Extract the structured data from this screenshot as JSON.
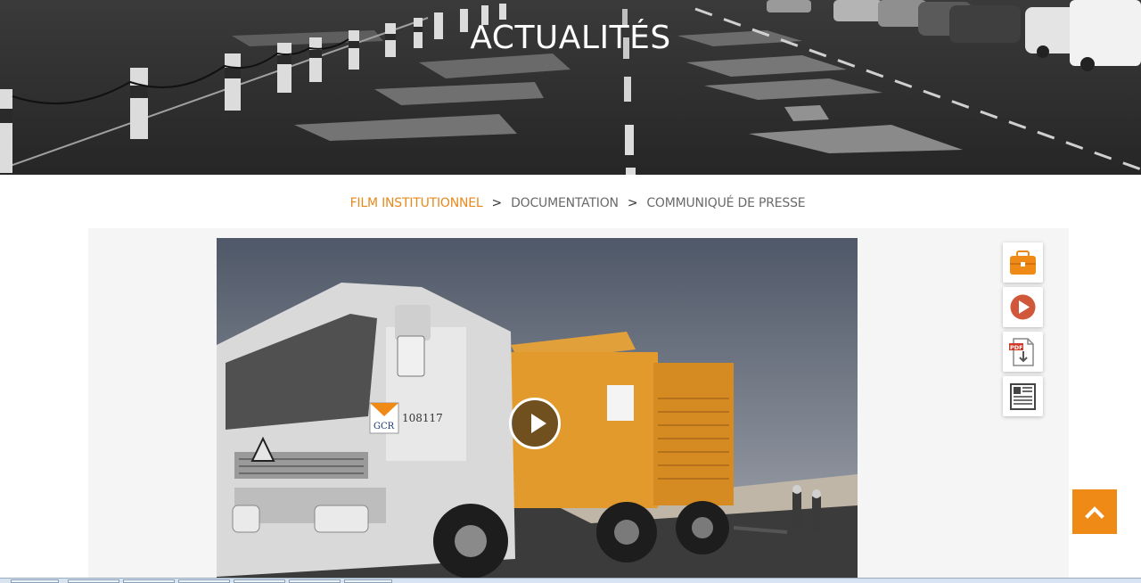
{
  "header": {
    "title": "ACTUALITÉS"
  },
  "breadcrumb": {
    "items": [
      {
        "label": "FILM INSTITUTIONNEL",
        "active": true
      },
      {
        "label": "DOCUMENTATION",
        "active": false
      },
      {
        "label": "COMMUNIQUÉ DE PRESSE",
        "active": false
      }
    ],
    "separator": ">"
  },
  "video": {
    "truck_number": "108117",
    "truck_logo": "GCR",
    "play_icon": "play-circle-icon"
  },
  "sidebar": {
    "items": [
      {
        "icon": "briefcase-icon"
      },
      {
        "icon": "play-icon"
      },
      {
        "icon": "pdf-download-icon"
      },
      {
        "icon": "newspaper-icon"
      }
    ]
  },
  "colors": {
    "accent": "#e8891d",
    "back_to_top": "#f08a17",
    "play_red": "#d0573a"
  },
  "back_to_top": {
    "icon": "chevron-up-icon"
  }
}
